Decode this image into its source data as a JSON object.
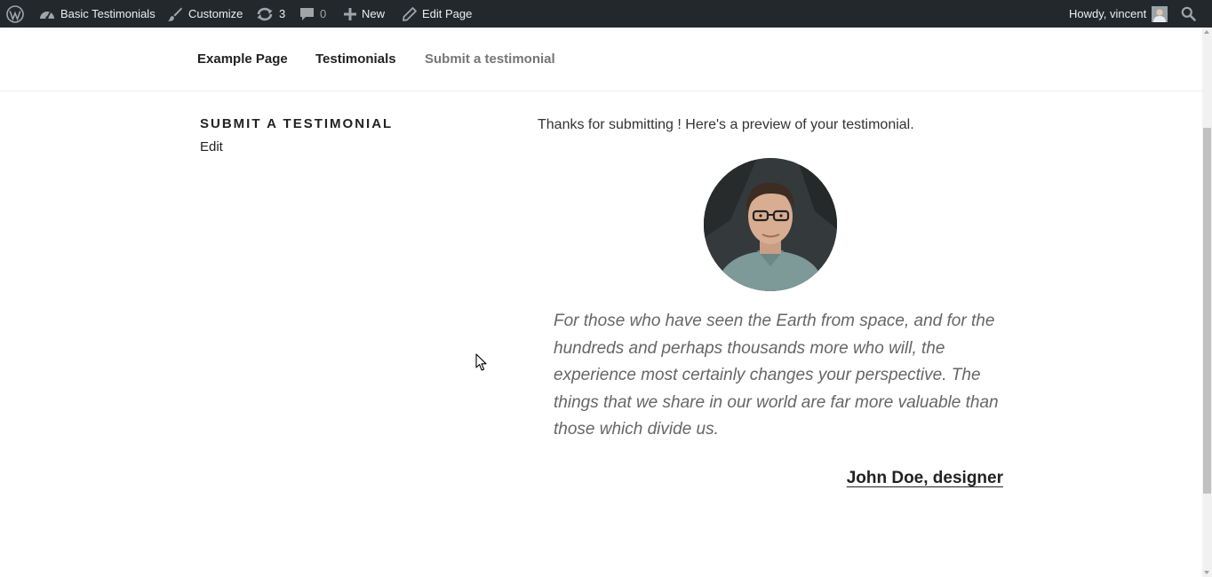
{
  "adminbar": {
    "site_name": "Basic Testimonials",
    "customize": "Customize",
    "updates_count": "3",
    "comments_count": "0",
    "new_label": "New",
    "edit_page": "Edit Page",
    "howdy": "Howdy, vincent"
  },
  "nav": {
    "items": [
      {
        "label": "Example Page"
      },
      {
        "label": "Testimonials"
      },
      {
        "label": "Submit a testimonial"
      }
    ]
  },
  "sidebar": {
    "title": "SUBMIT A TESTIMONIAL",
    "edit": "Edit"
  },
  "content": {
    "thanks": "Thanks for submitting ! Here's a preview of your testimonial.",
    "quote": "For those who have seen the Earth from space, and for the hundreds and perhaps thousands more who will, the experience most certainly changes your perspective. The things that we share in our world are far more valuable than those which divide us.",
    "author": "John Doe, designer"
  },
  "colors": {
    "adminbar_bg": "#23282d",
    "nav_current": "#767676",
    "quote_text": "#666666"
  }
}
